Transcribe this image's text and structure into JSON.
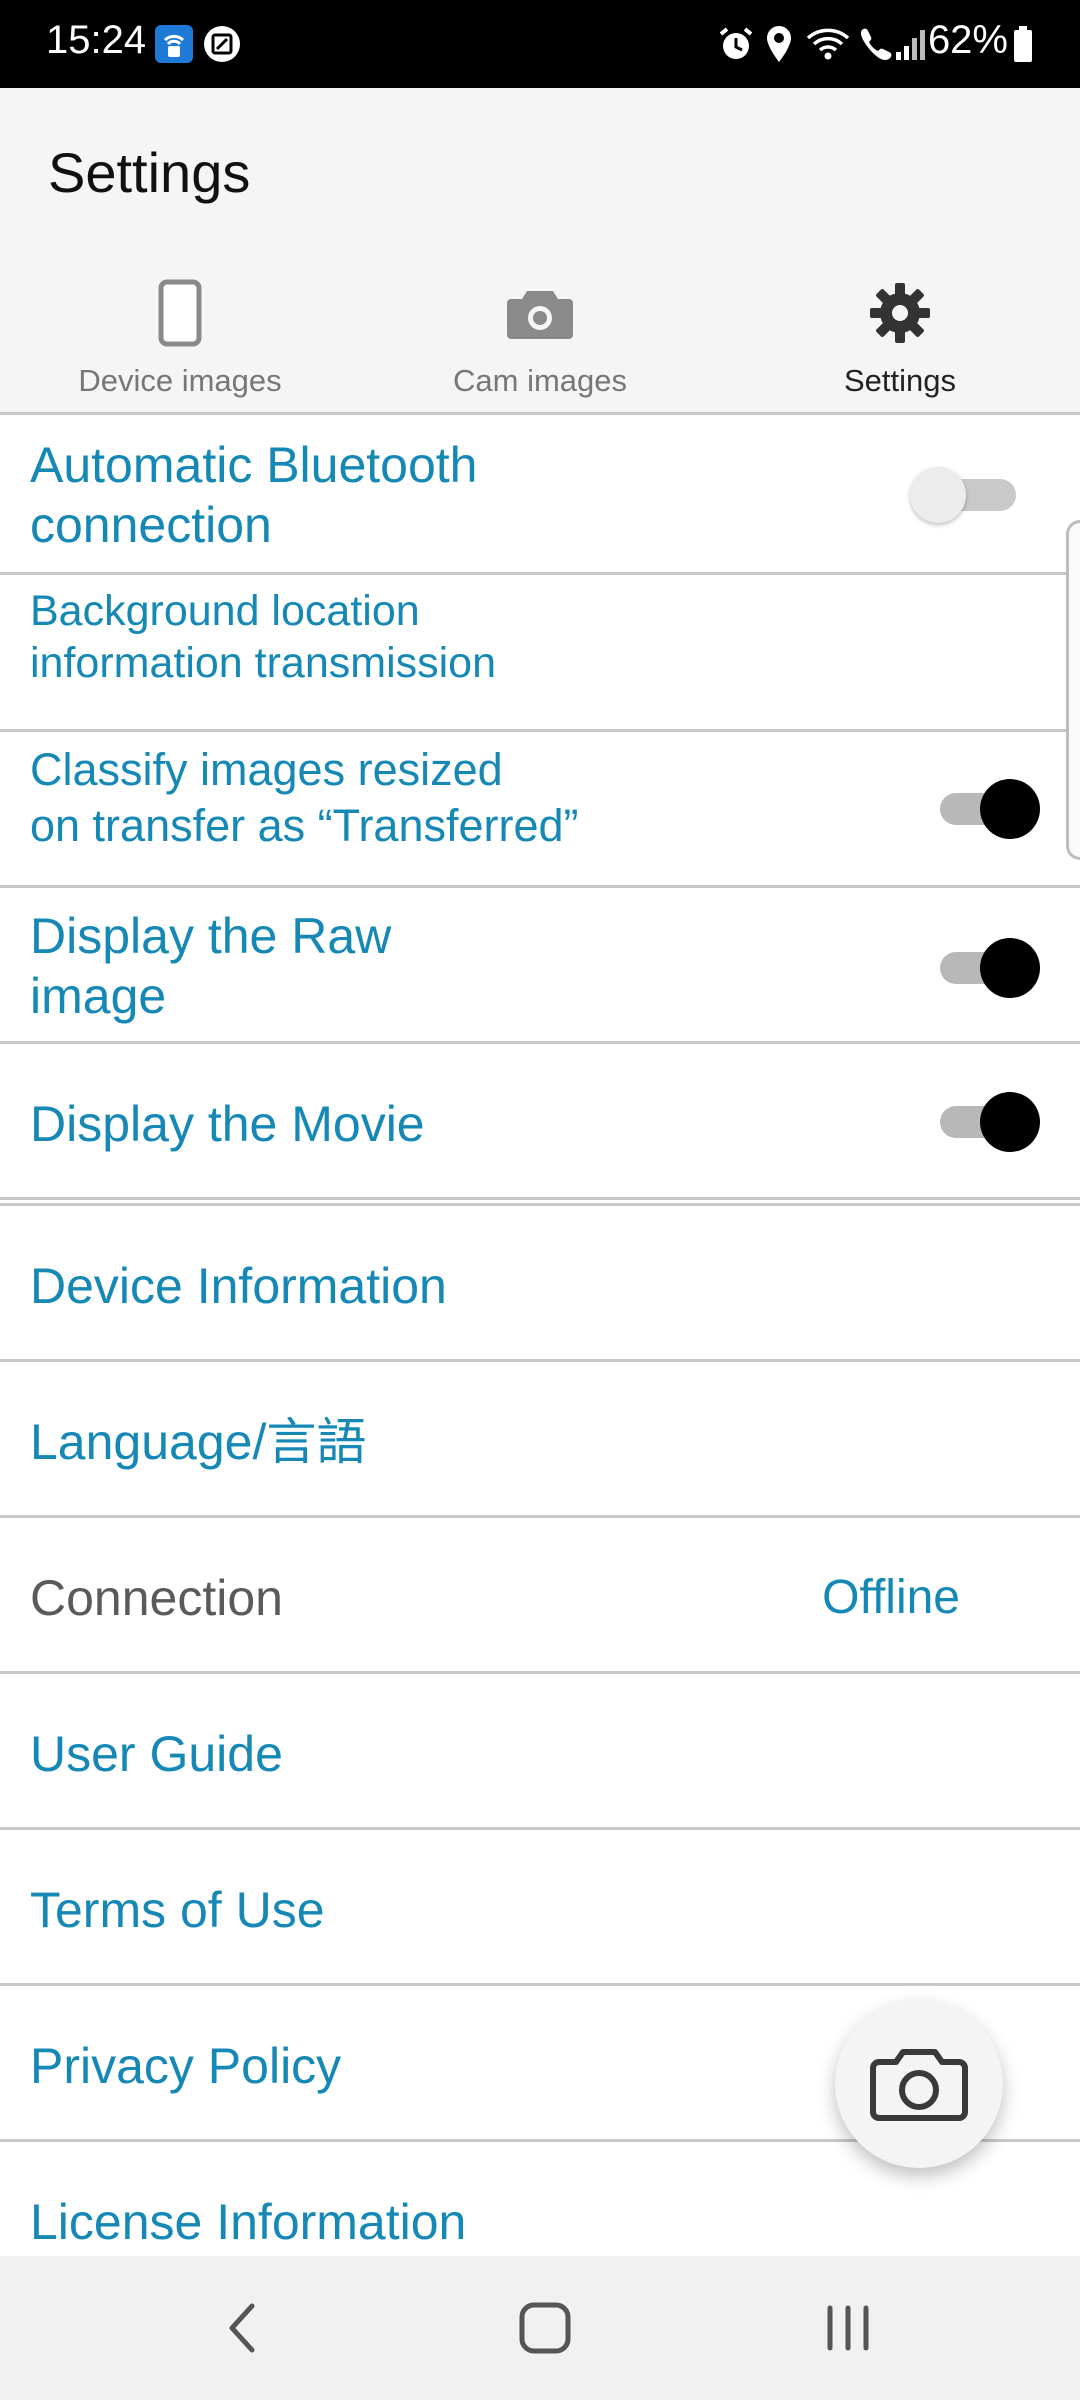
{
  "status_bar": {
    "time": "15:24",
    "battery": "62%",
    "icons": [
      "hotspot-icon",
      "screen-icon",
      "alarm-icon",
      "location-icon",
      "wifi-icon",
      "call-icon",
      "signal-icon",
      "battery-icon"
    ]
  },
  "header": {
    "title": "Settings"
  },
  "tabs": [
    {
      "label": "Device images",
      "icon": "phone-icon"
    },
    {
      "label": "Cam images",
      "icon": "camera-icon"
    },
    {
      "label": "Settings",
      "icon": "gear-icon",
      "active": true
    }
  ],
  "settings": [
    {
      "label_line1": "Automatic Bluetooth",
      "label_line2": "connection",
      "toggle": false
    },
    {
      "label_line1": "Background location",
      "label_line2": "information transmission"
    },
    {
      "label_line1": "Classify images resized",
      "label_line2": "on transfer as “Transferred”",
      "toggle": true
    },
    {
      "label_line1": "Display the Raw",
      "label_line2": "image",
      "toggle": true
    },
    {
      "label_line1": "Display the Movie",
      "toggle": true
    }
  ],
  "links": [
    {
      "label": "Device Information"
    },
    {
      "label": "Language/言語"
    },
    {
      "label": "Connection",
      "value": "Offline"
    },
    {
      "label": "User Guide"
    },
    {
      "label": "Terms of Use"
    },
    {
      "label": "Privacy Policy"
    },
    {
      "label": "License Information"
    }
  ],
  "colors": {
    "accent": "#1588b6",
    "divider": "#c8c8c8",
    "header_bg": "#f5f5f5"
  }
}
